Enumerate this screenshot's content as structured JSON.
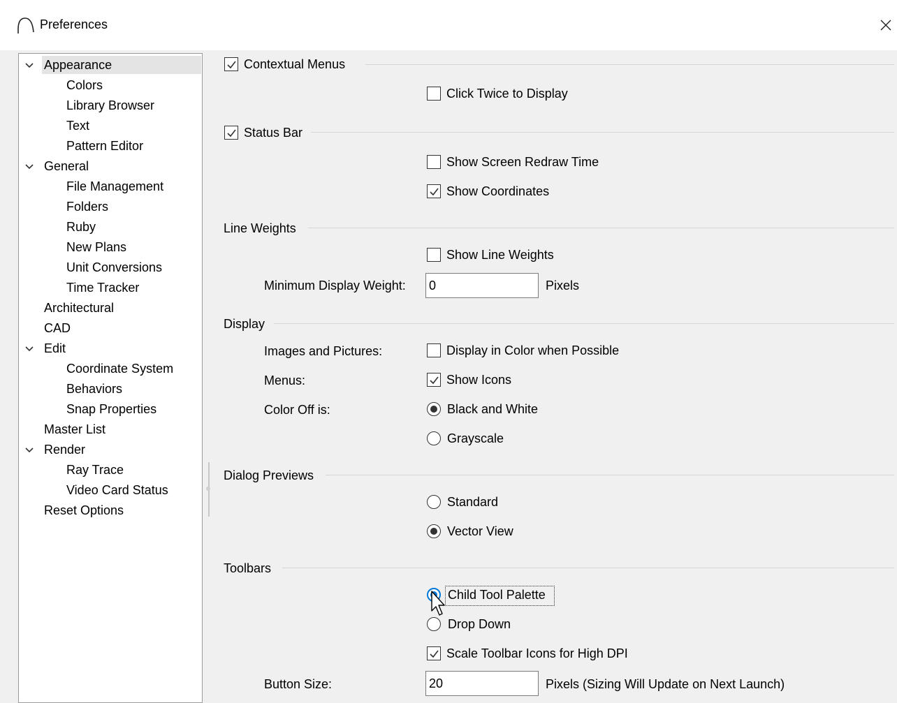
{
  "window": {
    "title": "Preferences",
    "app_icon": "arc-icon",
    "close_icon": "close-icon"
  },
  "tree": [
    {
      "label": "Appearance",
      "expanded": true,
      "selected": true,
      "level": 0
    },
    {
      "label": "Colors",
      "level": 1
    },
    {
      "label": "Library Browser",
      "level": 1
    },
    {
      "label": "Text",
      "level": 1
    },
    {
      "label": "Pattern Editor",
      "level": 1
    },
    {
      "label": "General",
      "expanded": true,
      "level": 0
    },
    {
      "label": "File Management",
      "level": 1
    },
    {
      "label": "Folders",
      "level": 1
    },
    {
      "label": "Ruby",
      "level": 1
    },
    {
      "label": "New Plans",
      "level": 1
    },
    {
      "label": "Unit Conversions",
      "level": 1
    },
    {
      "label": "Time Tracker",
      "level": 1
    },
    {
      "label": "Architectural",
      "level": 0
    },
    {
      "label": "CAD",
      "level": 0
    },
    {
      "label": "Edit",
      "expanded": true,
      "level": 0
    },
    {
      "label": "Coordinate System",
      "level": 1
    },
    {
      "label": "Behaviors",
      "level": 1
    },
    {
      "label": "Snap Properties",
      "level": 1
    },
    {
      "label": "Master List",
      "level": 0
    },
    {
      "label": "Render",
      "expanded": true,
      "level": 0
    },
    {
      "label": "Ray Trace",
      "level": 1
    },
    {
      "label": "Video Card Status",
      "level": 1
    },
    {
      "label": "Reset Options",
      "level": 0
    }
  ],
  "contextual_menus": {
    "label": "Contextual Menus",
    "checked": true,
    "click_twice": {
      "label": "Click Twice to Display",
      "checked": false
    }
  },
  "status_bar": {
    "label": "Status Bar",
    "checked": true,
    "redraw": {
      "label": "Show Screen Redraw Time",
      "checked": false
    },
    "coords": {
      "label": "Show Coordinates",
      "checked": true
    }
  },
  "line_weights": {
    "title": "Line Weights",
    "show": {
      "label": "Show Line Weights",
      "checked": false
    },
    "min_label": "Minimum Display Weight:",
    "min_value": "0",
    "unit": "Pixels"
  },
  "display": {
    "title": "Display",
    "images_label": "Images and Pictures:",
    "images_option": {
      "label": "Display in Color when Possible",
      "checked": false
    },
    "menus_label": "Menus:",
    "menus_option": {
      "label": "Show Icons",
      "checked": true
    },
    "color_off_label": "Color Off is:",
    "bw": {
      "label": "Black and White",
      "selected": true
    },
    "grayscale": {
      "label": "Grayscale",
      "selected": false
    }
  },
  "dialog_previews": {
    "title": "Dialog Previews",
    "standard": {
      "label": "Standard",
      "selected": false
    },
    "vector": {
      "label": "Vector View",
      "selected": true
    }
  },
  "toolbars": {
    "title": "Toolbars",
    "child_palette": {
      "label": "Child Tool Palette",
      "selected": true
    },
    "drop_down": {
      "label": "Drop Down",
      "selected": false
    },
    "scale": {
      "label": "Scale Toolbar Icons for High DPI",
      "checked": true
    },
    "button_size_label": "Button Size:",
    "button_size_value": "20",
    "button_size_unit": "Pixels (Sizing Will Update on Next Launch)"
  },
  "colors": {
    "focus_accent": "#0078d7",
    "selection": "#e4e4e4"
  }
}
